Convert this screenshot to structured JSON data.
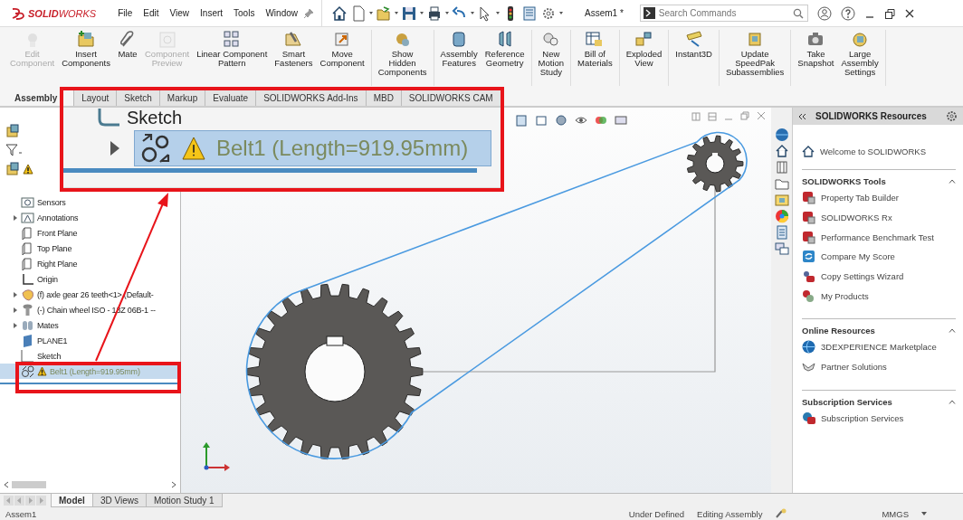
{
  "menubar": {
    "logo": "**SOLID**WORKS",
    "menus": [
      "File",
      "Edit",
      "View",
      "Insert",
      "Tools",
      "Window"
    ],
    "document_title": "Assem1 *",
    "search": {
      "placeholder": "Search Commands"
    }
  },
  "ribbon": [
    {
      "buttons": [
        {
          "label": "Edit\nComponent",
          "disabled": true
        },
        {
          "label": "Insert\nComponents",
          "disabled": false
        },
        {
          "label": "Mate",
          "disabled": false
        },
        {
          "label": "Component\nPreview",
          "disabled": true
        },
        {
          "label": "Linear Component\nPattern",
          "disabled": false
        },
        {
          "label": "Smart\nFasteners",
          "disabled": false
        },
        {
          "label": "Move\nComponent",
          "disabled": false
        }
      ]
    },
    {
      "buttons": [
        {
          "label": "Show\nHidden\nComponents",
          "disabled": false
        }
      ]
    },
    {
      "buttons": [
        {
          "label": "Assembly\nFeatures",
          "disabled": false
        },
        {
          "label": "Reference\nGeometry",
          "disabled": false
        }
      ]
    },
    {
      "buttons": [
        {
          "label": "New\nMotion\nStudy",
          "disabled": false
        }
      ]
    },
    {
      "buttons": [
        {
          "label": "Bill of\nMaterials",
          "disabled": false
        }
      ]
    },
    {
      "buttons": [
        {
          "label": "Exploded\nView",
          "disabled": false
        }
      ]
    },
    {
      "buttons": [
        {
          "label": "Instant3D",
          "disabled": false
        }
      ]
    },
    {
      "buttons": [
        {
          "label": "Update\nSpeedPak\nSubassemblies",
          "disabled": false
        }
      ]
    },
    {
      "buttons": [
        {
          "label": "Take\nSnapshot",
          "disabled": false
        },
        {
          "label": "Large\nAssembly\nSettings",
          "disabled": false
        }
      ]
    }
  ],
  "command_tabs": [
    {
      "label": "Assembly",
      "selected": true
    },
    {
      "label": "Layout",
      "selected": false
    },
    {
      "label": "Sketch",
      "selected": false
    },
    {
      "label": "Markup",
      "selected": false
    },
    {
      "label": "Evaluate",
      "selected": false
    },
    {
      "label": "SOLIDWORKS Add-Ins",
      "selected": false
    },
    {
      "label": "MBD",
      "selected": false
    },
    {
      "label": "SOLIDWORKS CAM",
      "selected": false
    }
  ],
  "tree": [
    {
      "label": "Sensors",
      "kind": "sensors",
      "collapsed": false,
      "selected": false,
      "warning": false
    },
    {
      "label": "Annotations",
      "kind": "annotations",
      "collapsed": true,
      "selected": false,
      "warning": false
    },
    {
      "label": "Front Plane",
      "kind": "plane",
      "collapsed": false,
      "selected": false,
      "warning": false
    },
    {
      "label": "Top Plane",
      "kind": "plane",
      "collapsed": false,
      "selected": false,
      "warning": false
    },
    {
      "label": "Right Plane",
      "kind": "plane",
      "collapsed": false,
      "selected": false,
      "warning": false
    },
    {
      "label": "Origin",
      "kind": "origin",
      "collapsed": false,
      "selected": false,
      "warning": false
    },
    {
      "label": "(f) axle gear 26 teeth<1> (Default-",
      "kind": "part",
      "collapsed": true,
      "selected": false,
      "warning": false
    },
    {
      "label": "(-) Chain wheel ISO - 13Z 06B-1 --",
      "kind": "chain-wheel",
      "collapsed": true,
      "selected": false,
      "warning": false
    },
    {
      "label": "Mates",
      "kind": "mates",
      "collapsed": true,
      "selected": false,
      "warning": false
    },
    {
      "label": "PLANE1",
      "kind": "solid-plane",
      "collapsed": false,
      "selected": false,
      "warning": false
    },
    {
      "label": "Sketch",
      "kind": "sketch",
      "collapsed": false,
      "selected": false,
      "warning": false
    },
    {
      "label": "Belt1 (Length=919.95mm)",
      "kind": "belt",
      "collapsed": false,
      "selected": true,
      "warning": true
    }
  ],
  "callout": {
    "item_above": "Sketch",
    "item": "Belt1 (Length=919.95mm)",
    "collapsed": true,
    "selected": true,
    "warning": true
  },
  "task_pane": {
    "title": "SOLIDWORKS Resources",
    "welcome": "Welcome to SOLIDWORKS",
    "sections": [
      {
        "title": "SOLIDWORKS Tools",
        "expanded": true,
        "items": [
          {
            "label": "Property Tab Builder",
            "kind": "red-tool"
          },
          {
            "label": "SOLIDWORKS Rx",
            "kind": "red-tool"
          },
          {
            "label": "Performance Benchmark Test",
            "kind": "red-tool"
          },
          {
            "label": "Compare My Score",
            "kind": "score"
          },
          {
            "label": "Copy Settings Wizard",
            "kind": "wizard"
          },
          {
            "label": "My Products",
            "kind": "products"
          }
        ]
      },
      {
        "title": "Online Resources",
        "expanded": true,
        "items": [
          {
            "label": "3DEXPERIENCE Marketplace",
            "kind": "globe"
          },
          {
            "label": "Partner Solutions",
            "kind": "handshake"
          }
        ]
      },
      {
        "title": "Subscription Services",
        "expanded": true,
        "items": [
          {
            "label": "Subscription Services",
            "kind": "subscription"
          }
        ]
      }
    ]
  },
  "bottom_tabs": [
    {
      "label": "Model",
      "selected": true
    },
    {
      "label": "3D Views",
      "selected": false
    },
    {
      "label": "Motion Study 1",
      "selected": false
    }
  ],
  "status_bar": {
    "document": "Assem1",
    "state": "Under Defined",
    "mode": "Editing Assembly",
    "units": "MMGS"
  }
}
